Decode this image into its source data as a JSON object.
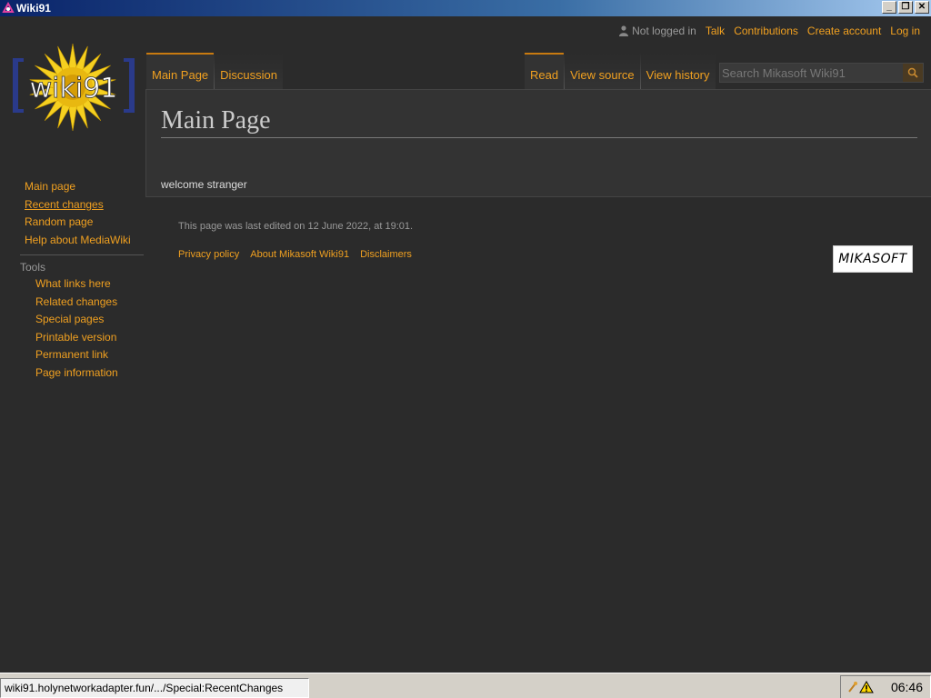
{
  "window": {
    "title": "Wiki91"
  },
  "personal": {
    "status": "Not logged in",
    "links": [
      "Talk",
      "Contributions",
      "Create account",
      "Log in"
    ]
  },
  "logo": {
    "text": "wiki91"
  },
  "tabs": {
    "left": [
      {
        "label": "Main Page",
        "selected": true
      },
      {
        "label": "Discussion",
        "selected": false
      }
    ],
    "right": [
      {
        "label": "Read",
        "selected": true
      },
      {
        "label": "View source",
        "selected": false
      },
      {
        "label": "View history",
        "selected": false
      }
    ]
  },
  "search": {
    "placeholder": "Search Mikasoft Wiki91",
    "value": ""
  },
  "content": {
    "heading": "Main Page",
    "body": "welcome stranger"
  },
  "navigation": {
    "items": [
      "Main page",
      "Recent changes",
      "Random page",
      "Help about MediaWiki"
    ]
  },
  "tools": {
    "heading": "Tools",
    "items": [
      "What links here",
      "Related changes",
      "Special pages",
      "Printable version",
      "Permanent link",
      "Page information"
    ]
  },
  "footer": {
    "last_edited": "This page was last edited on 12 June 2022, at 19:01.",
    "links": [
      "Privacy policy",
      "About Mikasoft Wiki91",
      "Disclaimers"
    ],
    "logo_text": "MIKASOFT"
  },
  "statusbar": {
    "url": "wiki91.holynetworkadapter.fun/.../Special:RecentChanges",
    "clock": "06:46"
  },
  "colors": {
    "accent": "#f0a020",
    "background": "#2b2b2b",
    "content_bg": "#333333",
    "tab_border": "#c87a10"
  }
}
